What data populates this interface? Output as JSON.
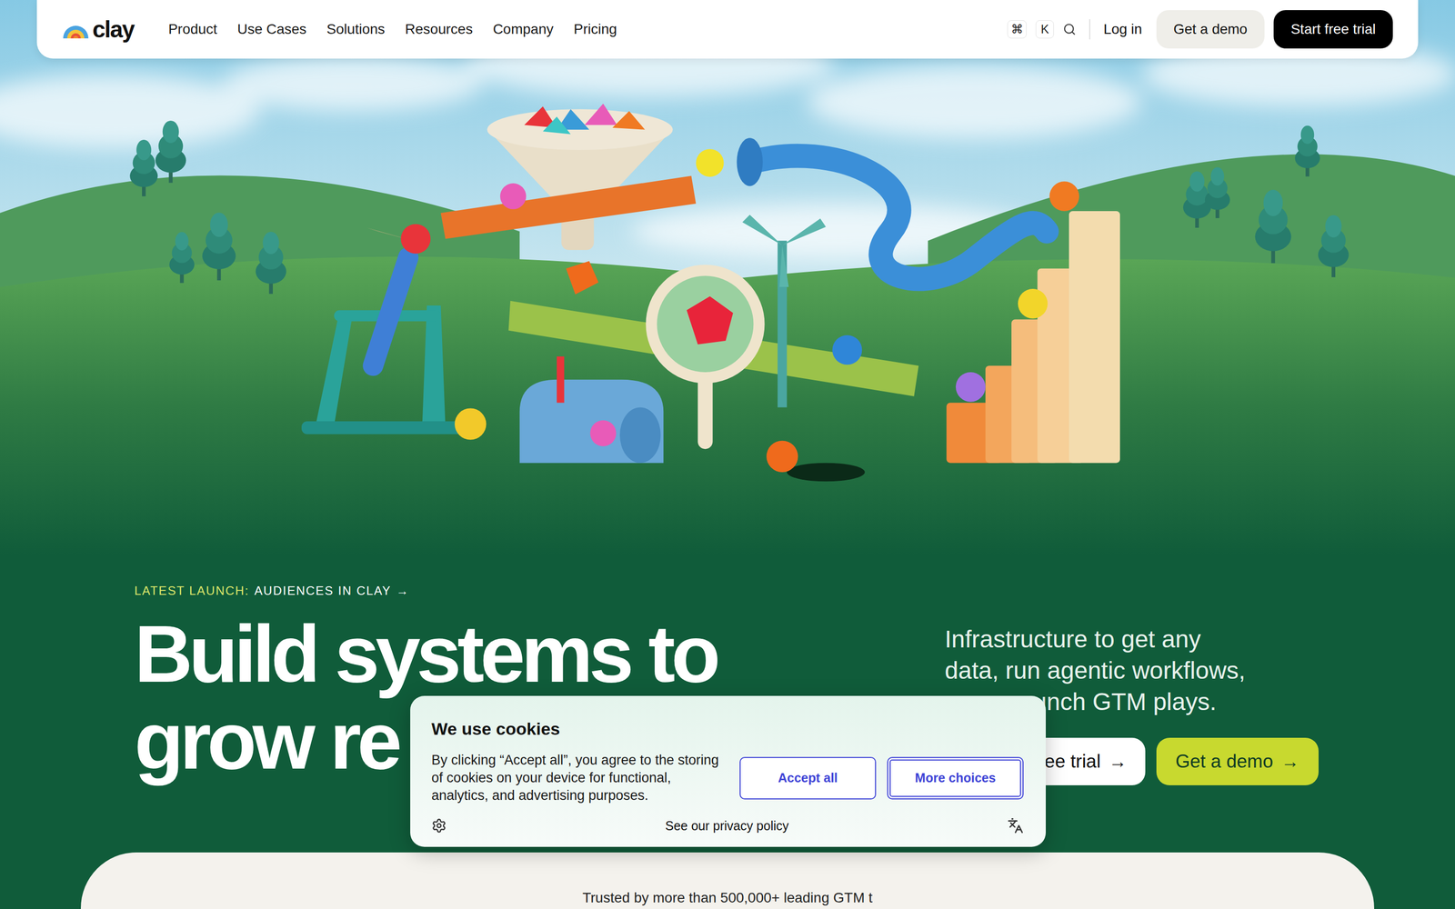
{
  "nav": {
    "logo": "clay",
    "items": [
      "Product",
      "Use Cases",
      "Solutions",
      "Resources",
      "Company",
      "Pricing"
    ],
    "shortcut": [
      "⌘",
      "K"
    ],
    "login": "Log in",
    "demo": "Get a demo",
    "trial": "Start free trial"
  },
  "hero": {
    "launch_label": "LATEST LAUNCH:",
    "launch_title": "AUDIENCES IN CLAY",
    "launch_arrow": "→",
    "headline": [
      "Build systems to",
      "grow re"
    ],
    "subtitle": [
      "Infrastructure to get any",
      "data, run agentic workflows,",
      "unch GTM plays."
    ],
    "buttons": [
      {
        "label": "free trial",
        "arrow": "→",
        "kind": "secondary"
      },
      {
        "label": "Get a demo",
        "arrow": "→",
        "kind": "primary"
      }
    ]
  },
  "trusted": "Trusted by more than 500,000+ leading GTM t",
  "cookie_banner": {
    "title": "We use cookies",
    "body": "By clicking “Accept all”, you agree to the storing of cookies on your device for functional, analytics, and advertising purposes.",
    "buttons": [
      {
        "label": "Accept all",
        "focused": false
      },
      {
        "label": "More choices",
        "focused": true
      }
    ],
    "privacy_link": "See our privacy policy"
  }
}
